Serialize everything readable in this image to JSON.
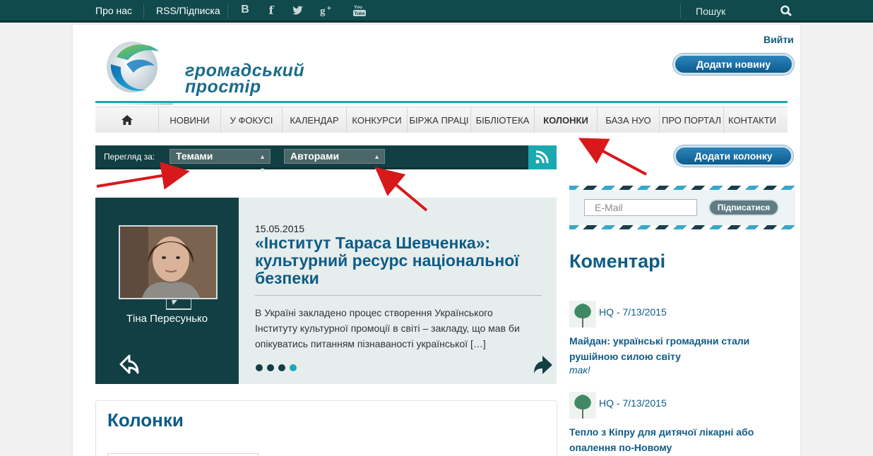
{
  "topbar": {
    "about": "Про нас",
    "rss": "RSS/Підписка",
    "social": [
      "В",
      "f"
    ],
    "search_placeholder": "Пошук"
  },
  "header": {
    "logo_line1": "громадський",
    "logo_line2": "простір",
    "logout": "Вийти",
    "add_news": "Додати новину"
  },
  "nav": {
    "items": [
      {
        "label": "Новини"
      },
      {
        "label": "У фокусі"
      },
      {
        "label": "Календар"
      },
      {
        "label": "Конкурси"
      },
      {
        "label": "Біржа праці"
      },
      {
        "label": "Бібліотека"
      },
      {
        "label": "Колонки",
        "active": true
      },
      {
        "label": "База НУО"
      },
      {
        "label": "Про портал"
      },
      {
        "label": "Контакти"
      }
    ]
  },
  "filter": {
    "label": "Перегляд за:",
    "topics": "Темами",
    "authors": "Авторами"
  },
  "featured": {
    "author": "Тіна Пересунько",
    "date": "15.05.2015",
    "title": "«Інститут Тараса Шевченка»: культурний ресурс національної безпеки",
    "excerpt": "В Україні закладено процес створення Українського Інституту культурної промоції в світі – закладу, що мав би опікуватись питанням пізнаваності української […]",
    "slides": 4,
    "active_slide": 4
  },
  "columns": {
    "title": "Колонки"
  },
  "sidebar": {
    "add_column": "Додати колонку",
    "email_placeholder": "E-Mail",
    "subscribe": "Підписатися",
    "comments_title": "Коментарі",
    "comments": [
      {
        "meta": "HQ - 7/13/2015",
        "title": "Майдан: українські громадяни стали рушійною силою світу",
        "text": "так!"
      },
      {
        "meta": "HQ - 7/13/2015",
        "title": "Тепло з Кіпру для дитячої лікарні або опалення по-Новому",
        "text": ""
      }
    ]
  },
  "colors": {
    "dark_teal": "#123f44",
    "accent_teal": "#1aa9b0",
    "link_blue": "#0e5c86",
    "arrow_red": "#d7191c"
  }
}
